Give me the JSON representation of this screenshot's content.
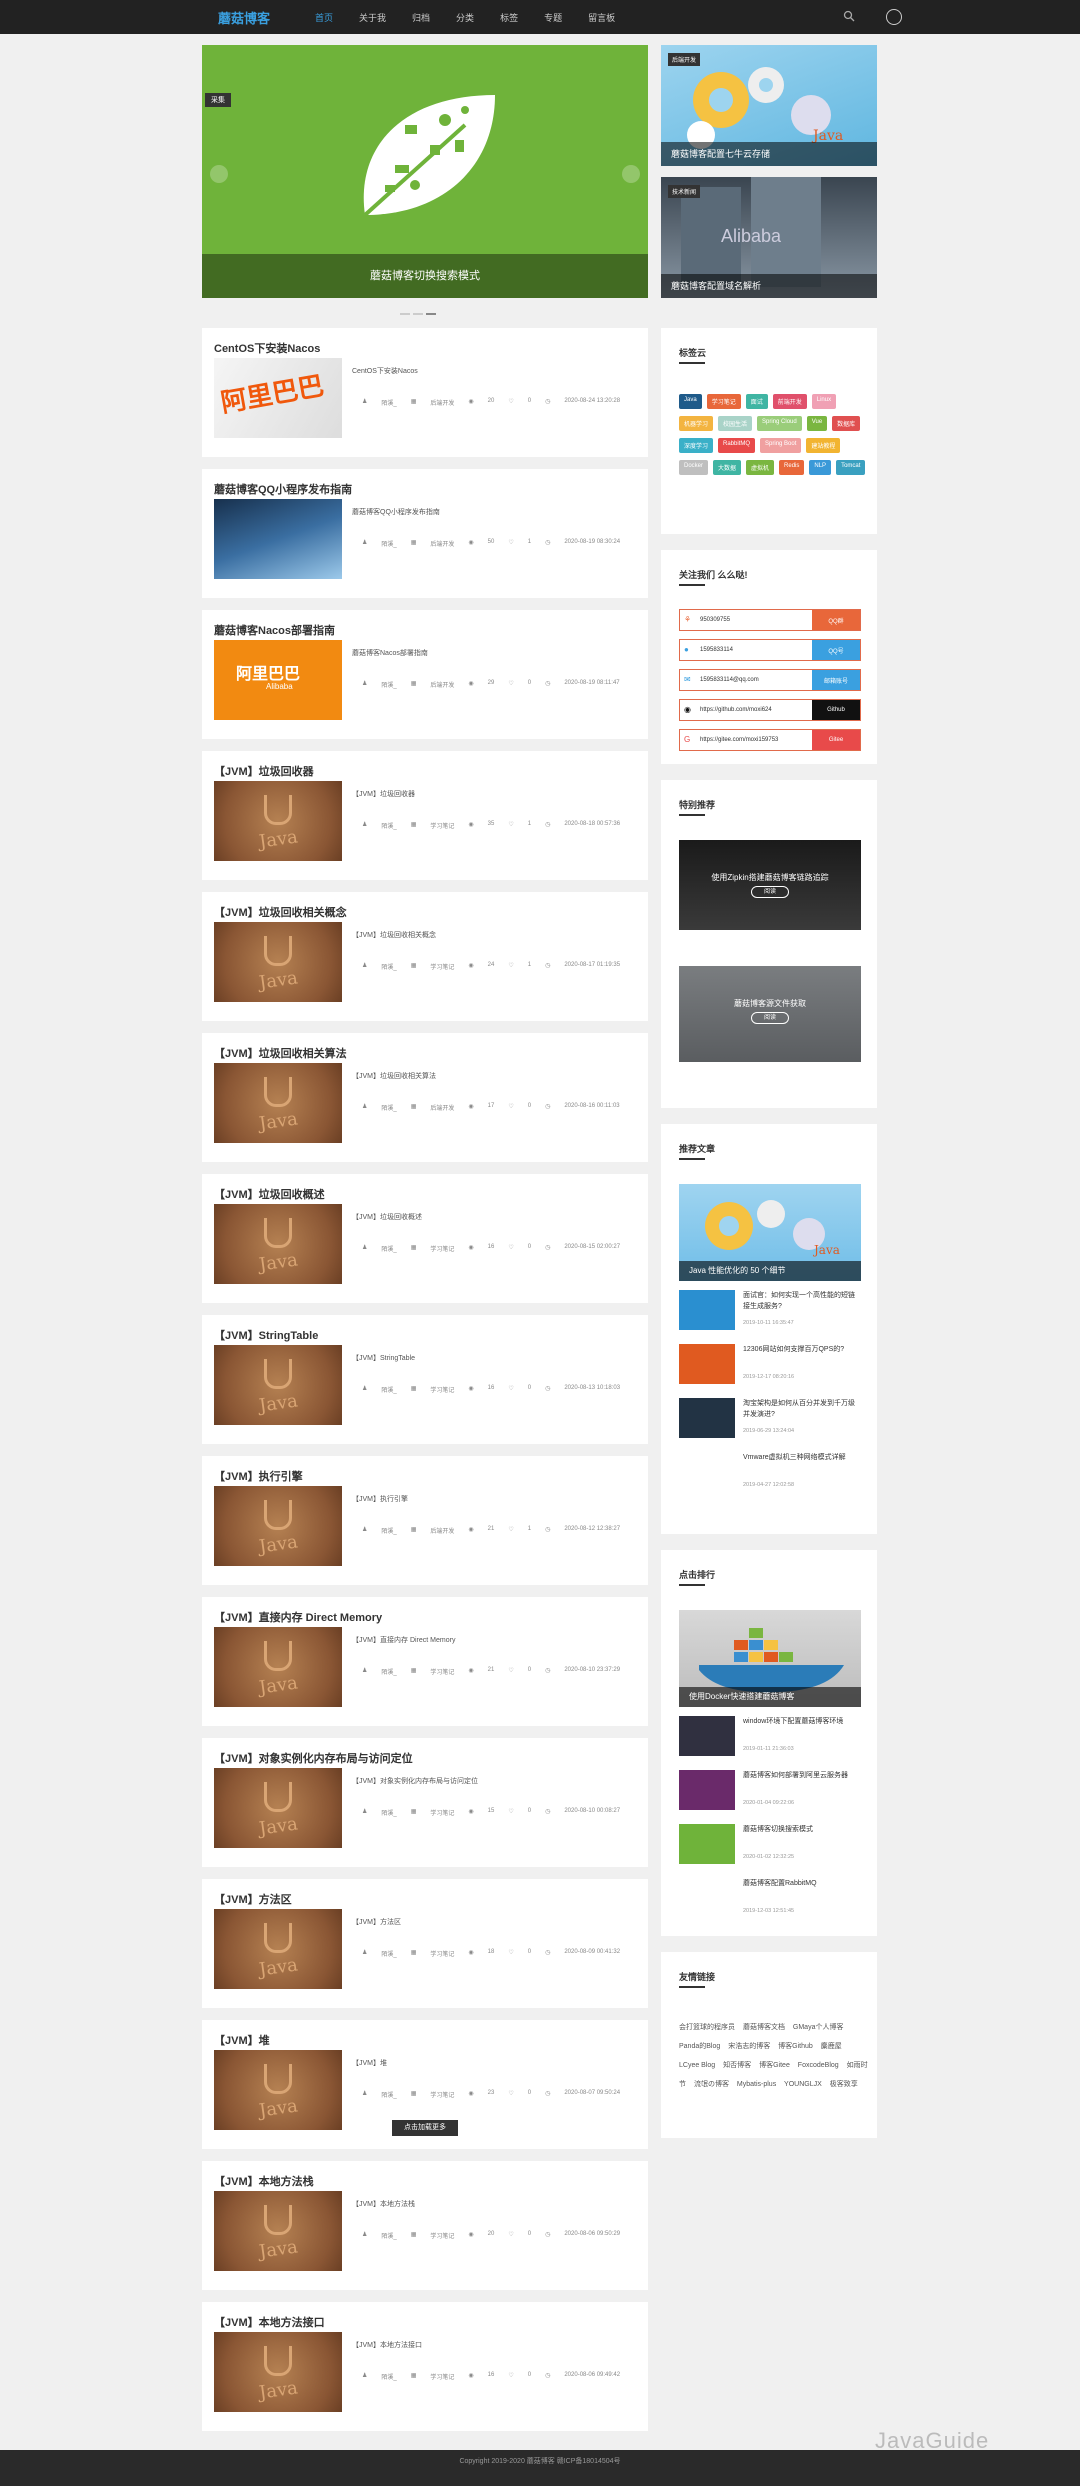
{
  "nav": {
    "logo": "蘑菇博客",
    "items": [
      "首页",
      "关于我",
      "归档",
      "分类",
      "标签",
      "专题",
      "留言板"
    ]
  },
  "carousel": {
    "tag": "采集",
    "caption": "蘑菇博客切换搜索模式"
  },
  "side_banners": [
    {
      "tag": "后端开发",
      "caption": "蘑菇博客配置七牛云存储"
    },
    {
      "tag": "技术新闻",
      "caption": "蘑菇博客配置域名解析"
    }
  ],
  "posts": [
    {
      "title": "CentOS下安装Nacos",
      "summary": "CentOS下安装Nacos",
      "author": "陌溪_",
      "category": "后端开发",
      "views": "20",
      "likes": "0",
      "date": "2020-08-24 13:20:28",
      "thumb": "alibaba"
    },
    {
      "title": "蘑菇博客QQ小程序发布指南",
      "summary": "蘑菇博客QQ小程序发布指南",
      "author": "陌溪_",
      "category": "后端开发",
      "views": "50",
      "likes": "1",
      "date": "2020-08-19 08:30:24",
      "thumb": "qq"
    },
    {
      "title": "蘑菇博客Nacos部署指南",
      "summary": "蘑菇博客Nacos部署指南",
      "author": "陌溪_",
      "category": "后端开发",
      "views": "29",
      "likes": "0",
      "date": "2020-08-19 08:11:47",
      "thumb": "alibaba2"
    },
    {
      "title": "【JVM】垃圾回收器",
      "summary": "【JVM】垃圾回收器",
      "author": "陌溪_",
      "category": "学习笔记",
      "views": "35",
      "likes": "1",
      "date": "2020-08-18 00:57:36",
      "thumb": "java"
    },
    {
      "title": "【JVM】垃圾回收相关概念",
      "summary": "【JVM】垃圾回收相关概念",
      "author": "陌溪_",
      "category": "学习笔记",
      "views": "24",
      "likes": "1",
      "date": "2020-08-17 01:19:35",
      "thumb": "java"
    },
    {
      "title": "【JVM】垃圾回收相关算法",
      "summary": "【JVM】垃圾回收相关算法",
      "author": "陌溪_",
      "category": "后端开发",
      "views": "17",
      "likes": "0",
      "date": "2020-08-16 00:11:03",
      "thumb": "java"
    },
    {
      "title": "【JVM】垃圾回收概述",
      "summary": "【JVM】垃圾回收概述",
      "author": "陌溪_",
      "category": "学习笔记",
      "views": "16",
      "likes": "0",
      "date": "2020-08-15 02:00:27",
      "thumb": "java"
    },
    {
      "title": "【JVM】StringTable",
      "summary": "【JVM】StringTable",
      "author": "陌溪_",
      "category": "学习笔记",
      "views": "16",
      "likes": "0",
      "date": "2020-08-13 10:18:03",
      "thumb": "java"
    },
    {
      "title": "【JVM】执行引擎",
      "summary": "【JVM】执行引擎",
      "author": "陌溪_",
      "category": "后端开发",
      "views": "21",
      "likes": "1",
      "date": "2020-08-12 12:38:27",
      "thumb": "java"
    },
    {
      "title": "【JVM】直接内存 Direct Memory",
      "summary": "【JVM】直接内存 Direct Memory",
      "author": "陌溪_",
      "category": "学习笔记",
      "views": "21",
      "likes": "0",
      "date": "2020-08-10 23:37:29",
      "thumb": "java"
    },
    {
      "title": "【JVM】对象实例化内存布局与访问定位",
      "summary": "【JVM】对象实例化内存布局与访问定位",
      "author": "陌溪_",
      "category": "学习笔记",
      "views": "15",
      "likes": "0",
      "date": "2020-08-10 00:08:27",
      "thumb": "java"
    },
    {
      "title": "【JVM】方法区",
      "summary": "【JVM】方法区",
      "author": "陌溪_",
      "category": "学习笔记",
      "views": "18",
      "likes": "0",
      "date": "2020-08-09 00:41:32",
      "thumb": "java"
    },
    {
      "title": "【JVM】堆",
      "summary": "【JVM】堆",
      "author": "陌溪_",
      "category": "学习笔记",
      "views": "23",
      "likes": "0",
      "date": "2020-08-07 09:50:24",
      "thumb": "java"
    },
    {
      "title": "【JVM】本地方法栈",
      "summary": "【JVM】本地方法栈",
      "author": "陌溪_",
      "category": "学习笔记",
      "views": "20",
      "likes": "0",
      "date": "2020-08-06 09:50:29",
      "thumb": "java"
    },
    {
      "title": "【JVM】本地方法接口",
      "summary": "【JVM】本地方法接口",
      "author": "陌溪_",
      "category": "学习笔记",
      "views": "16",
      "likes": "0",
      "date": "2020-08-06 09:49:42",
      "thumb": "java"
    }
  ],
  "load_more": "点击加载更多",
  "tag_cloud": {
    "title": "标签云",
    "tags": [
      {
        "label": "Java",
        "color": "#1f5b8a"
      },
      {
        "label": "学习笔记",
        "color": "#e8673a"
      },
      {
        "label": "面试",
        "color": "#3fb5a3"
      },
      {
        "label": "前端开发",
        "color": "#e0506b"
      },
      {
        "label": "Linux",
        "color": "#f0a0b4"
      },
      {
        "label": "机器学习",
        "color": "#f3b440"
      },
      {
        "label": "校园生活",
        "color": "#a9d3c8"
      },
      {
        "label": "Spring Cloud",
        "color": "#9acd7a"
      },
      {
        "label": "Vue",
        "color": "#7ab640"
      },
      {
        "label": "数据库",
        "color": "#e05050"
      },
      {
        "label": "深度学习",
        "color": "#3ab0c8"
      },
      {
        "label": "RabbitMQ",
        "color": "#e84a4a"
      },
      {
        "label": "Spring Boot",
        "color": "#f0a0a0"
      },
      {
        "label": "建站教程",
        "color": "#f2b431"
      },
      {
        "label": "Docker",
        "color": "#bfbfbf"
      },
      {
        "label": "大数据",
        "color": "#3fb5a3"
      },
      {
        "label": "虚拟机",
        "color": "#7ab640"
      },
      {
        "label": "Redis",
        "color": "#e8673a"
      },
      {
        "label": "NLP",
        "color": "#3a99d8"
      },
      {
        "label": "Tomcat",
        "color": "#3aa0c0"
      }
    ]
  },
  "follow": {
    "title": "关注我们 么么哒!",
    "rows": [
      {
        "icon": "qq-group-icon",
        "value": "950309755",
        "btn": "QQ群",
        "color": "#e8673a"
      },
      {
        "icon": "qq-icon",
        "value": "1595833114",
        "btn": "QQ号",
        "color": "#3aa0e0"
      },
      {
        "icon": "mail-icon",
        "value": "1595833114@qq.com",
        "btn": "邮箱账号",
        "color": "#3aa0e0"
      },
      {
        "icon": "github-icon",
        "value": "https://github.com/moxi624",
        "btn": "Github",
        "color": "#111111"
      },
      {
        "icon": "gitee-icon",
        "value": "https://gitee.com/moxi159753",
        "btn": "Gitee",
        "color": "#e84a4a"
      }
    ]
  },
  "special": {
    "title": "特别推荐",
    "items": [
      {
        "caption": "使用Zipkin搭建蘑菇博客链路追踪",
        "btn": "阅读"
      },
      {
        "caption": "蘑菇博客源文件获取",
        "btn": "阅读"
      }
    ]
  },
  "recommend": {
    "title": "推荐文章",
    "big_caption": "Java 性能优化的 50 个细节",
    "items": [
      {
        "title": "面试官：如何实现一个高性能的短链接生成服务?",
        "date": "2019-10-11 16:35:47",
        "thumb": "#2a8fd0"
      },
      {
        "title": "12306网站如何支撑百万QPS的?",
        "date": "2019-12-17 08:20:16",
        "thumb": "#e05a20"
      },
      {
        "title": "淘宝架构是如何从百分并发到千万级并发演进?",
        "date": "2019-06-29 13:24:04",
        "thumb": "#223344"
      },
      {
        "title": "Vmware虚拟机三种网络模式详解",
        "date": "2019-04-27 12:02:58",
        "thumb": "#ffffff"
      }
    ]
  },
  "ranking": {
    "title": "点击排行",
    "big_caption": "使用Docker快速搭建蘑菇博客",
    "items": [
      {
        "title": "window环境下配置蘑菇博客环境",
        "date": "2019-01-11 21:36:03",
        "thumb": "#303040"
      },
      {
        "title": "蘑菇博客如何部署到阿里云服务器",
        "date": "2020-01-04 09:22:06",
        "thumb": "#6a2a6a"
      },
      {
        "title": "蘑菇博客切换搜索模式",
        "date": "2020-01-02 12:32:25",
        "thumb": "#6fb33a"
      },
      {
        "title": "蘑菇博客配置RabbitMQ",
        "date": "2019-12-03 12:51:45",
        "thumb": "#ffffff"
      }
    ]
  },
  "friend_links": {
    "title": "友情链接",
    "links": [
      "会打篮球的程序员",
      "蘑菇博客文档",
      "GMaya个人博客",
      "Panda的Blog",
      "宋浩志的博客",
      "博客Github",
      "麋鹿屋",
      "LCyee Blog",
      "知否博客",
      "博客Gitee",
      "FoxcodeBlog",
      "如雨时节",
      "流氓の博客",
      "Mybatis-plus",
      "YOUNGLJX",
      "极客致享"
    ]
  },
  "footer": "Copyright 2019-2020 蘑菇博客 赣ICP备18014504号",
  "watermark": "JavaGuide"
}
